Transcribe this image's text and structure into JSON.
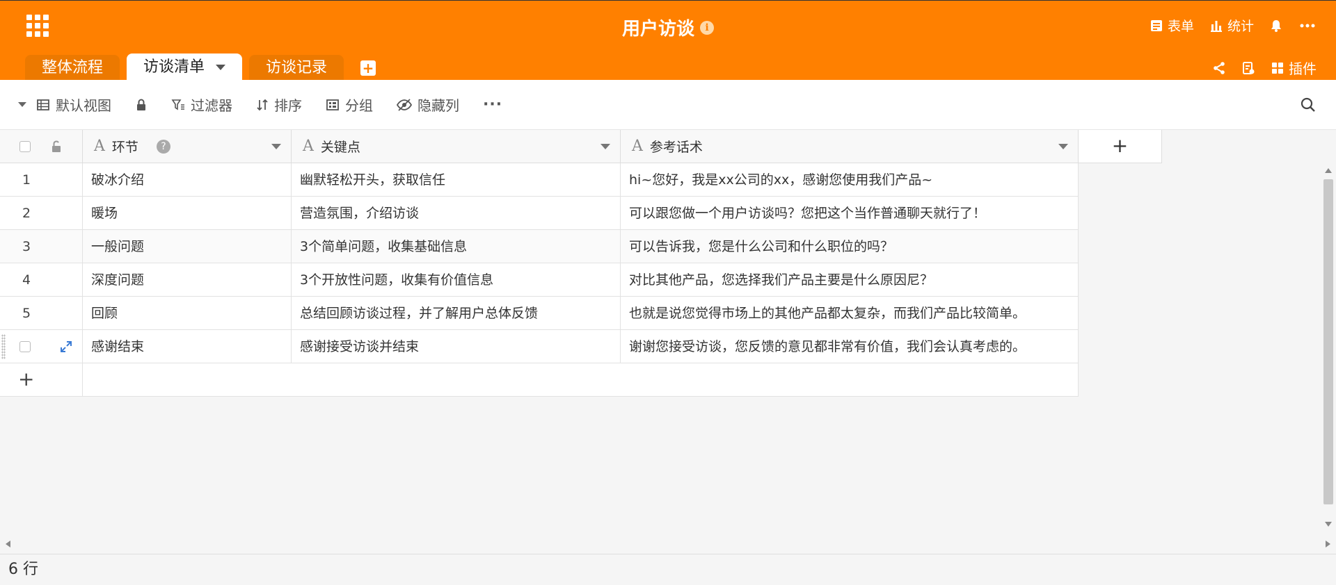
{
  "app": {
    "title": "用户访谈",
    "info_icon": "i"
  },
  "top_actions": [
    {
      "icon": "form-icon",
      "label": "表单"
    },
    {
      "icon": "stats-icon",
      "label": "统计"
    }
  ],
  "top_right_secondary": {
    "plugins_label": "插件"
  },
  "tabs": [
    {
      "label": "整体流程",
      "active": false
    },
    {
      "label": "访谈清单",
      "active": true
    },
    {
      "label": "访谈记录",
      "active": false
    }
  ],
  "toolbar": {
    "view_label": "默认视图",
    "filter_label": "过滤器",
    "sort_label": "排序",
    "group_label": "分组",
    "hide_columns_label": "隐藏列",
    "more_label": "···"
  },
  "table": {
    "columns": [
      {
        "icon": "text-field-icon",
        "label": "环节",
        "help": "?"
      },
      {
        "icon": "text-field-icon",
        "label": "关键点"
      },
      {
        "icon": "text-field-icon",
        "label": "参考话术"
      }
    ],
    "add_column_label": "+",
    "add_row_label": "+",
    "rows": [
      {
        "index": "1",
        "stage": "破冰介绍",
        "key_point": "幽默轻松开头，获取信任",
        "script": "hi~您好，我是xx公司的xx，感谢您使用我们产品~"
      },
      {
        "index": "2",
        "stage": "暖场",
        "key_point": "营造氛围，介绍访谈",
        "script": "可以跟您做一个用户访谈吗？您把这个当作普通聊天就行了！"
      },
      {
        "index": "3",
        "stage": "一般问题",
        "key_point": "3个简单问题，收集基础信息",
        "script": "可以告诉我，您是什么公司和什么职位的吗？"
      },
      {
        "index": "4",
        "stage": "深度问题",
        "key_point": "3个开放性问题，收集有价值信息",
        "script": "对比其他产品，您选择我们产品主要是什么原因尼？"
      },
      {
        "index": "5",
        "stage": "回顾",
        "key_point": "总结回顾访谈过程，并了解用户总体反馈",
        "script": "也就是说您觉得市场上的其他产品都太复杂，而我们产品比较简单。"
      },
      {
        "index": "",
        "stage": "感谢结束",
        "key_point": "感谢接受访谈并结束",
        "script": "谢谢您接受访谈，您反馈的意见都非常有价值，我们会认真考虑的。"
      }
    ]
  },
  "status": {
    "row_count": "6 行"
  },
  "colors": {
    "brand": "#ff8000",
    "tab_inactive": "#ec7900"
  }
}
